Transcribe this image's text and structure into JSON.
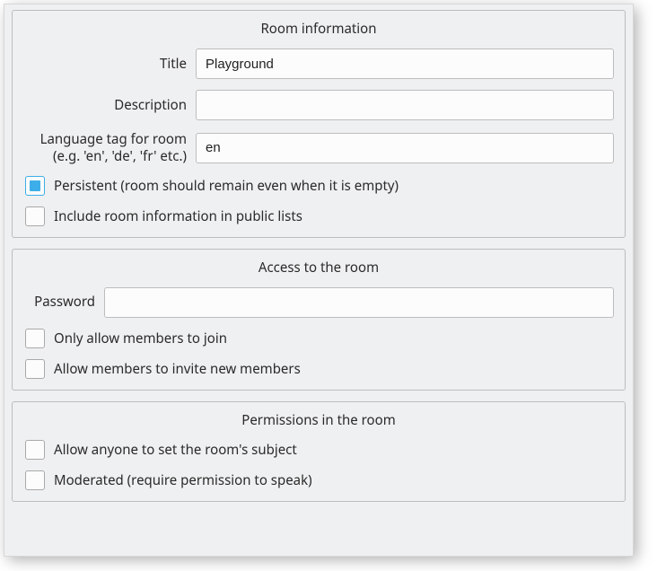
{
  "room_info": {
    "legend": "Room information",
    "title_label": "Title",
    "title_value": "Playground",
    "description_label": "Description",
    "description_value": "",
    "language_label": "Language tag for room (e.g. 'en', 'de', 'fr' etc.)",
    "language_value": "en",
    "persistent_label": "Persistent (room should remain even when it is empty)",
    "persistent_checked": true,
    "include_public_label": "Include room information in public lists",
    "include_public_checked": false
  },
  "access": {
    "legend": "Access to the room",
    "password_label": "Password",
    "password_value": "",
    "members_only_label": "Only allow members to join",
    "members_only_checked": false,
    "allow_invite_label": "Allow members to invite new members",
    "allow_invite_checked": false
  },
  "permissions": {
    "legend": "Permissions in the room",
    "anyone_subject_label": "Allow anyone to set the room's subject",
    "anyone_subject_checked": false,
    "moderated_label": "Moderated (require permission to speak)",
    "moderated_checked": false
  }
}
